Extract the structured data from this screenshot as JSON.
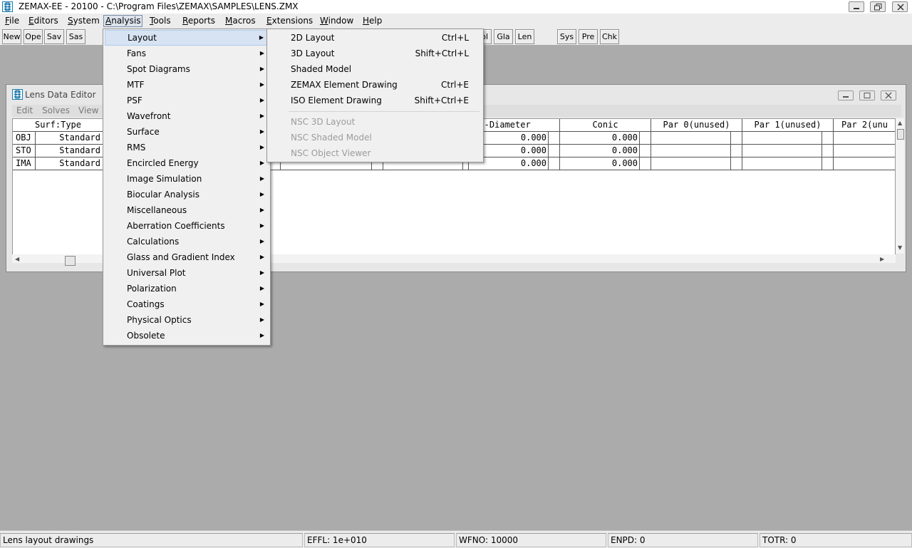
{
  "window": {
    "title": "ZEMAX-EE - 20100 - C:\\Program Files\\ZEMAX\\SAMPLES\\LENS.ZMX",
    "icon": "zemax-app-icon",
    "controls": [
      "minimize-icon",
      "restore-icon",
      "close-icon"
    ]
  },
  "menubar": [
    {
      "label": "File",
      "u": "F",
      "rest": "ile"
    },
    {
      "label": "Editors",
      "u": "E",
      "rest": "ditors"
    },
    {
      "label": "System",
      "u": "S",
      "rest": "ystem"
    },
    {
      "label": "Analysis",
      "u": "A",
      "rest": "nalysis"
    },
    {
      "label": "Tools",
      "u": "T",
      "rest": "ools"
    },
    {
      "label": "Reports",
      "u": "R",
      "rest": "eports"
    },
    {
      "label": "Macros",
      "u": "M",
      "rest": "acros"
    },
    {
      "label": "Extensions",
      "u": "E",
      "rest": "xtensions"
    },
    {
      "label": "Window",
      "u": "W",
      "rest": "indow"
    },
    {
      "label": "Help",
      "u": "H",
      "rest": "elp"
    }
  ],
  "toolbar": [
    "New",
    "Ope",
    "Sav",
    "Sas",
    "bl",
    "Gla",
    "Len",
    "Sys",
    "Pre",
    "Chk"
  ],
  "lens_editor": {
    "title": "Lens Data Editor",
    "menu": [
      "Edit",
      "Solves",
      "View"
    ],
    "columns": {
      "surf_type": "Surf:Type",
      "semi_diameter": "emi-Diameter",
      "conic": "Conic",
      "par0": "Par 0(unused)",
      "par1": "Par 1(unused)",
      "par2": "Par 2(unu"
    },
    "rows": [
      {
        "surf": "OBJ",
        "type": "Standard",
        "semi_diameter": "0.000",
        "conic": "0.000"
      },
      {
        "surf": "STO",
        "type": "Standard",
        "semi_diameter": "0.000",
        "conic": "0.000"
      },
      {
        "surf": "IMA",
        "type": "Standard",
        "semi_diameter": "0.000",
        "conic": "0.000"
      }
    ]
  },
  "analysis_menu": [
    "Layout",
    "Fans",
    "Spot Diagrams",
    "MTF",
    "PSF",
    "Wavefront",
    "Surface",
    "RMS",
    "Encircled Energy",
    "Image Simulation",
    "Biocular Analysis",
    "Miscellaneous",
    "Aberration Coefficients",
    "Calculations",
    "Glass and Gradient Index",
    "Universal Plot",
    "Polarization",
    "Coatings",
    "Physical Optics",
    "Obsolete"
  ],
  "layout_submenu": {
    "enabled": [
      {
        "label": "2D Layout",
        "shortcut": "Ctrl+L"
      },
      {
        "label": "3D Layout",
        "shortcut": "Shift+Ctrl+L"
      },
      {
        "label": "Shaded Model",
        "shortcut": ""
      },
      {
        "label": "ZEMAX Element Drawing",
        "shortcut": "Ctrl+E"
      },
      {
        "label": "ISO Element Drawing",
        "shortcut": "Shift+Ctrl+E"
      }
    ],
    "disabled": [
      "NSC 3D Layout",
      "NSC Shaded Model",
      "NSC Object Viewer"
    ]
  },
  "statusbar": {
    "help": "Lens layout drawings",
    "effl": "EFFL: 1e+010",
    "wfno": "WFNO: 10000",
    "enpd": "ENPD: 0",
    "totr": "TOTR: 0"
  },
  "colors": {
    "desktop": "#ababab",
    "menu_highlight": "#d7e3f3",
    "disabled_text": "#9c9c9c"
  }
}
